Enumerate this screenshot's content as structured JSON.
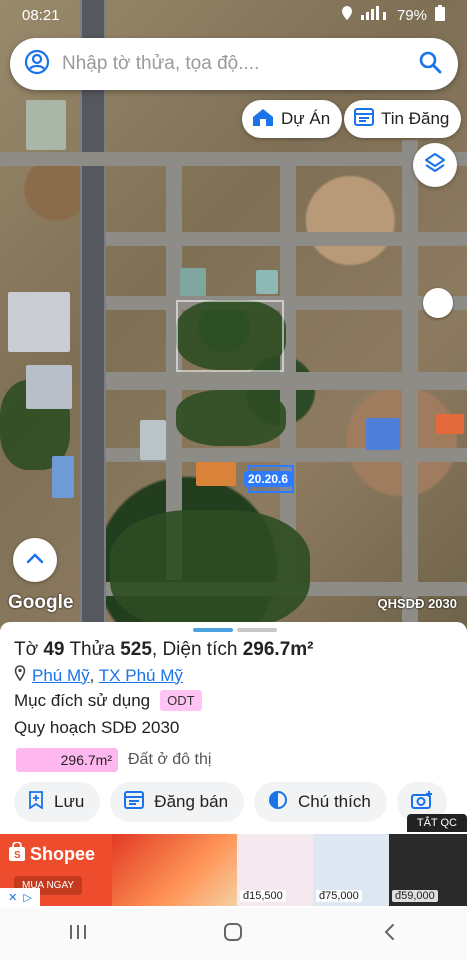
{
  "status_bar": {
    "time": "08:21",
    "battery": "79%"
  },
  "search": {
    "placeholder": "Nhập tờ thửa, tọa độ...."
  },
  "chips": {
    "project": "Dự Án",
    "listing": "Tin Đăng"
  },
  "map": {
    "provider": "Google",
    "layer": "QHSDĐ 2030",
    "parcel_label": "20.20.6"
  },
  "parcel": {
    "sheet_label": "Tờ",
    "sheet_no": "49",
    "parcel_label": "Thửa",
    "parcel_no": "525",
    "area_label": "Diện tích",
    "area": "296.7m²",
    "ward": "Phú Mỹ",
    "separator": ",",
    "town": "TX Phú Mỹ",
    "purpose_label": "Mục đích sử dụng",
    "purpose_code": "ODT",
    "plan_title": "Quy hoạch SDĐ 2030",
    "plan_area": "296.7m²",
    "plan_use": "Đất ở đô thị"
  },
  "actions": {
    "save": "Lưu",
    "post": "Đăng bán",
    "legend": "Chú thích"
  },
  "ad": {
    "close_label": "TẮT QC",
    "shopee": "Shopee",
    "shopee_cta": "MUA NGAY",
    "prices": [
      "đ15,500",
      "đ75,000",
      "đ59,000"
    ]
  },
  "colors": {
    "accent": "#1a73e8",
    "odt_badge": "#ffc4f3",
    "plan_bar": "#ffb8ef",
    "shopee": "#ee4d2d",
    "handle_active": "#4aa3df",
    "handle_inactive": "#c8c8c8"
  },
  "icons": {
    "search": "search-icon",
    "user": "user-icon",
    "layers": "layers-icon"
  }
}
